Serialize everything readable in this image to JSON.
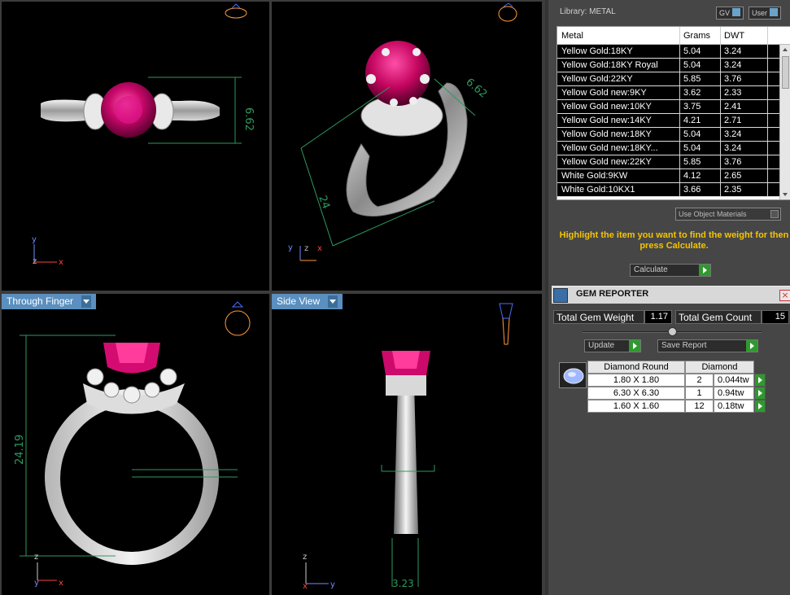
{
  "viewports": {
    "top_left": {
      "dimension": "6.62"
    },
    "top_right": {
      "dimension_a": "6.62",
      "dimension_b": "24"
    },
    "bottom_left": {
      "tab": "Through Finger",
      "dimension": "24.19"
    },
    "bottom_right": {
      "tab": "Side View",
      "dimension": "3.23"
    }
  },
  "axes": {
    "x": "x",
    "y": "y",
    "z": "z"
  },
  "library": {
    "header": "Library: METAL",
    "gv_label": "GV",
    "user_label": "User",
    "columns": [
      "Metal",
      "Grams",
      "DWT"
    ],
    "rows": [
      [
        "Yellow Gold:18KY",
        "5.04",
        "3.24"
      ],
      [
        "Yellow Gold:18KY Royal",
        "5.04",
        "3.24"
      ],
      [
        "Yellow Gold:22KY",
        "5.85",
        "3.76"
      ],
      [
        "Yellow Gold new:9KY",
        "3.62",
        "2.33"
      ],
      [
        "Yellow Gold new:10KY",
        "3.75",
        "2.41"
      ],
      [
        "Yellow Gold new:14KY",
        "4.21",
        "2.71"
      ],
      [
        "Yellow Gold new:18KY",
        "5.04",
        "3.24"
      ],
      [
        "Yellow Gold new:18KY...",
        "5.04",
        "3.24"
      ],
      [
        "Yellow Gold new:22KY",
        "5.85",
        "3.76"
      ],
      [
        "White Gold:9KW",
        "4.12",
        "2.65"
      ],
      [
        "White Gold:10KX1",
        "3.66",
        "2.35"
      ]
    ],
    "use_object_materials": "Use Object Materials",
    "hint": "Highlight the item you want to find the weight for then press Calculate.",
    "calculate_label": "Calculate"
  },
  "gem_reporter": {
    "title": "GEM REPORTER",
    "total_weight_label": "Total Gem Weight",
    "total_weight_value": "1.17",
    "total_count_label": "Total Gem Count",
    "total_count_value": "15",
    "update_label": "Update",
    "save_report_label": "Save Report",
    "table_header": [
      "Diamond Round",
      "Diamond"
    ],
    "rows": [
      [
        "1.80 X 1.80",
        "2",
        "0.044tw"
      ],
      [
        "6.30 X 6.30",
        "1",
        "0.94tw"
      ],
      [
        "1.60 X 1.60",
        "12",
        "0.18tw"
      ]
    ]
  },
  "colors": {
    "accent_tab": "#5a8fbf",
    "hint_text": "#f5c400",
    "go_button": "#2e9a2e",
    "ruby": "#d0106e",
    "dimension_line": "#2e9a5e"
  },
  "icons": [
    "ring-preview-icon",
    "dropdown-arrow-icon",
    "gem-reporter-icon",
    "close-icon",
    "go-arrow-icon",
    "diamond-thumbnail-icon"
  ]
}
